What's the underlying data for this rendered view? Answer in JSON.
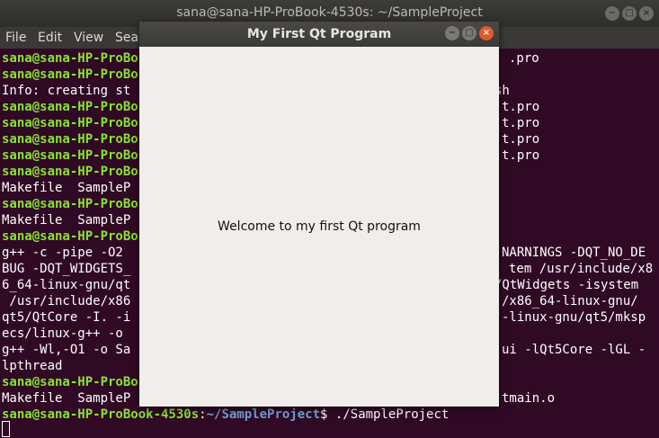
{
  "terminal": {
    "title": "sana@sana-HP-ProBook-4530s: ~/SampleProject",
    "menu": [
      "File",
      "Edit",
      "View",
      "Sear"
    ],
    "lines": [
      {
        "left": "sana@sana-HP-ProBo",
        "right": ".pro"
      },
      {
        "left": "sana@sana-HP-ProBo",
        "right": ""
      },
      {
        "left": "Info: creating st",
        "right": "sh"
      },
      {
        "left": "sana@sana-HP-ProBo",
        "right": "t.pro"
      },
      {
        "left": "sana@sana-HP-ProBo",
        "right": "t.pro"
      },
      {
        "left": "sana@sana-HP-ProBo",
        "right": "t.pro"
      },
      {
        "left": "sana@sana-HP-ProBo",
        "right": "t.pro"
      },
      {
        "left": "sana@sana-HP-ProBo",
        "right": ""
      },
      {
        "left": "Makefile  SampleP",
        "right": ""
      },
      {
        "left": "sana@sana-HP-ProBo",
        "right": ""
      },
      {
        "left": "Makefile  SampleP",
        "right": ""
      },
      {
        "left": "sana@sana-HP-ProBo",
        "right": ""
      },
      {
        "left": "g++ -c -pipe -O2",
        "right": "NARNINGS -DQT_NO_DE"
      },
      {
        "left": "BUG -DQT_WIDGETS_",
        "right": "tem /usr/include/x8"
      },
      {
        "left": "6_64-linux-gnu/qt",
        "right": "/QtWidgets -isystem"
      },
      {
        "left": " /usr/include/x86",
        "right": "/x86_64-linux-gnu/"
      },
      {
        "left": "qt5/QtCore -I. -i",
        "right": "-linux-gnu/qt5/mksp"
      },
      {
        "left": "ecs/linux-g++ -o",
        "right": ""
      },
      {
        "left": "g++ -Wl,-O1 -o Sa",
        "right": "ui -lQt5Core -lGL -"
      },
      {
        "left": "lpthread",
        "right": ""
      },
      {
        "left": "sana@sana-HP-ProBo",
        "right": ""
      },
      {
        "left": "Makefile  SampleP",
        "right": "tmain.o"
      }
    ],
    "prompt_user": "sana@sana-HP-ProBook-4530s",
    "prompt_path": "~/SampleProject",
    "prompt_symbol": "$",
    "prompt_command": "./SampleProject",
    "colors": {
      "background": "#300a24",
      "user": "#8ae234",
      "path": "#729fcf"
    }
  },
  "qt_window": {
    "title": "My First Qt Program",
    "label": "Welcome to my first Qt program"
  },
  "controls": {
    "minimize": "−",
    "maximize": "□",
    "close": "×"
  }
}
